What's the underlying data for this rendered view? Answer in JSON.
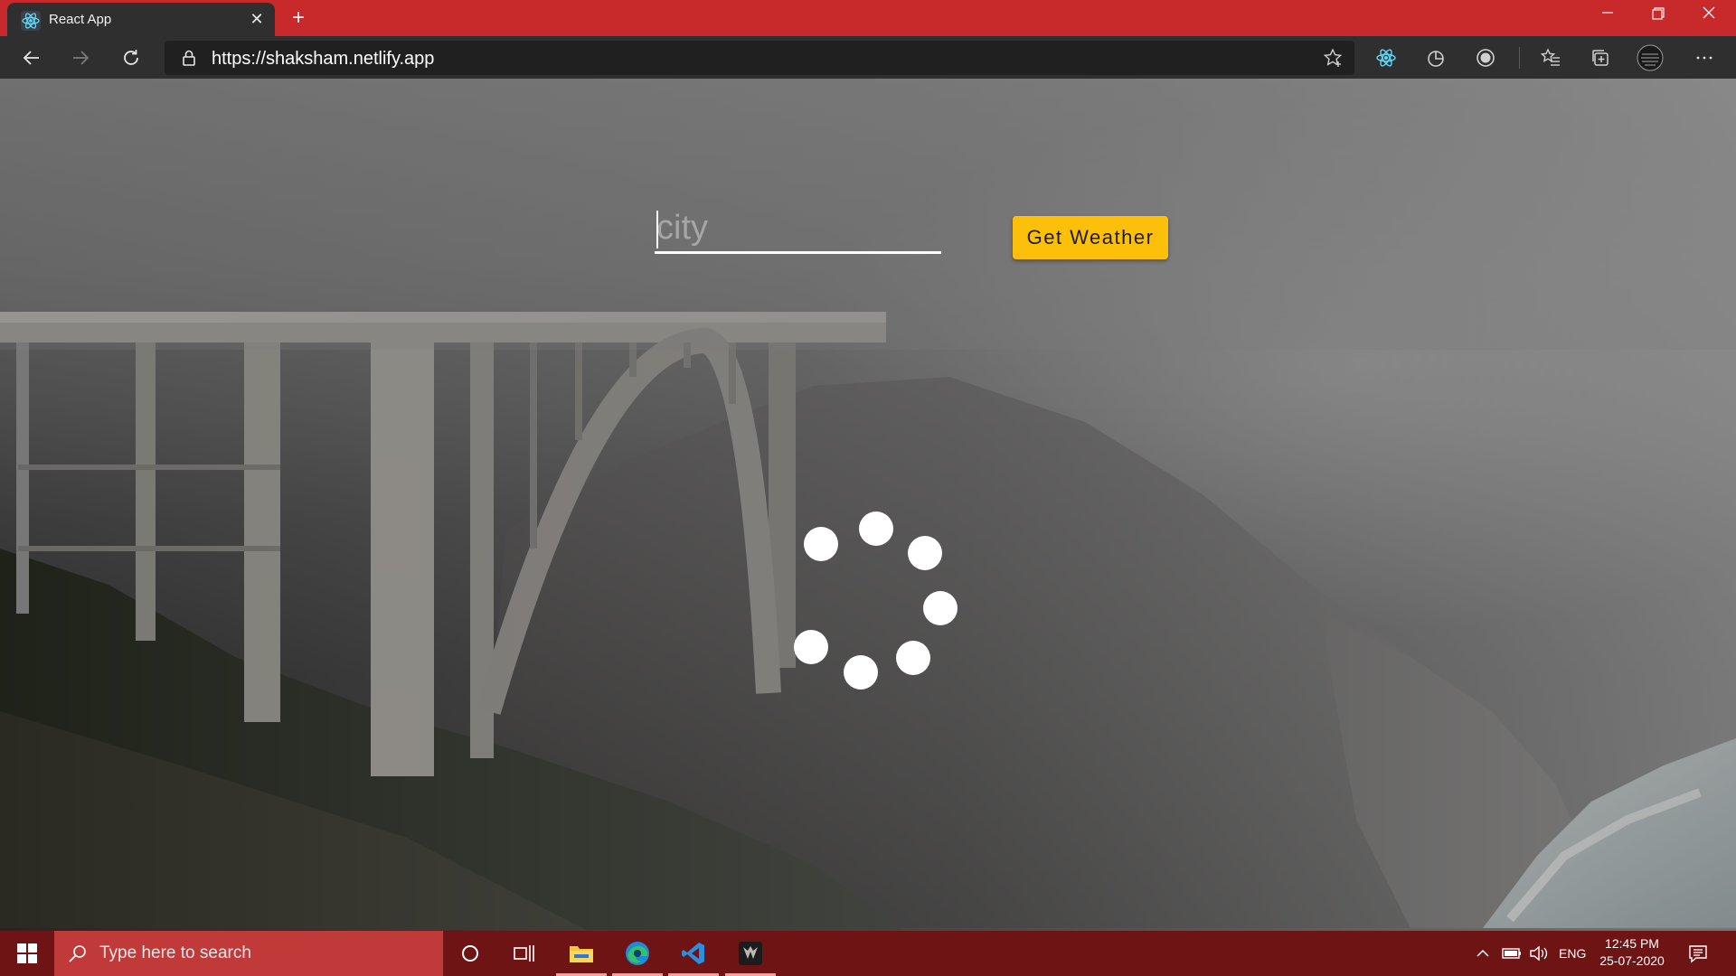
{
  "browser": {
    "tab": {
      "title": "React App",
      "favicon": "react-icon"
    },
    "new_tab_icon": "plus-icon",
    "window_controls": [
      "minimize-icon",
      "restore-icon",
      "close-icon"
    ],
    "address_bar": {
      "url": "https://shaksham.netlify.app"
    },
    "nav_icons": [
      "back-arrow-icon",
      "forward-arrow-icon",
      "refresh-icon",
      "lock-icon",
      "favorite-star-icon"
    ],
    "toolbar_icons": [
      "react-devtools-icon",
      "extension-icon",
      "extension-circle-icon",
      "favorites-icon",
      "collections-icon",
      "profile-avatar",
      "more-icon"
    ]
  },
  "app": {
    "city_input": {
      "placeholder": "city",
      "value": ""
    },
    "get_weather_button": "Get Weather",
    "loader": {
      "dot_count": 7
    }
  },
  "taskbar": {
    "search_placeholder": "Type here to search",
    "language": "ENG",
    "time": "12:45 PM",
    "date": "25-07-2020",
    "pinned_apps": [
      "cortana-icon",
      "task-view-icon",
      "file-explorer-icon",
      "edge-icon",
      "vscode-icon",
      "predator-sense-icon"
    ]
  },
  "colors": {
    "titlebar": "#c8292b",
    "accent_button": "#fcc00b",
    "taskbar": "#6e1414"
  }
}
